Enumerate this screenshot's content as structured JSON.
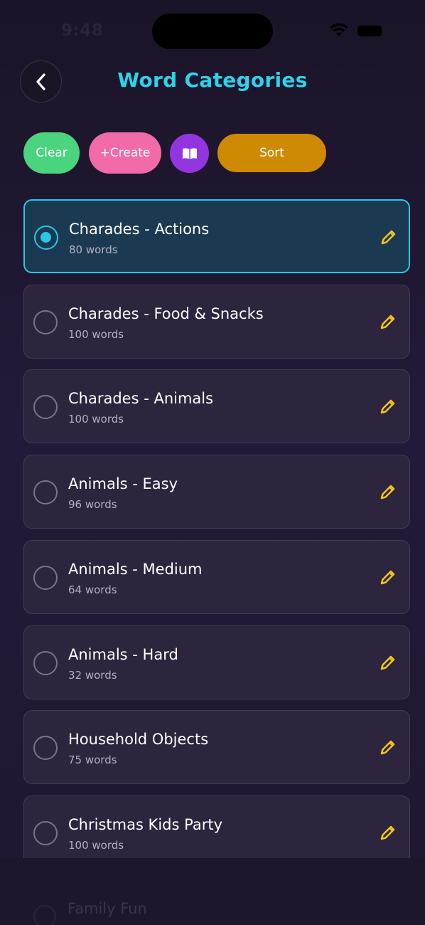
{
  "status_bar": {
    "time": "9:48"
  },
  "header": {
    "title": "Word Categories"
  },
  "toolbar": {
    "clear_label": "Clear",
    "create_label": "+Create",
    "sort_label": "Sort"
  },
  "colors": {
    "title": "#2ed3ea",
    "clear": "#4ad47e",
    "create": "#f26aa8",
    "book": "#9235e0",
    "sort": "#cf8a04",
    "selected_border": "#2bc6e6",
    "edit_icon": "#f3c418"
  },
  "categories": [
    {
      "name": "Charades - Actions",
      "count": "80 words",
      "selected": true
    },
    {
      "name": "Charades - Food & Snacks",
      "count": "100 words",
      "selected": false
    },
    {
      "name": "Charades - Animals",
      "count": "100 words",
      "selected": false
    },
    {
      "name": "Animals - Easy",
      "count": "96 words",
      "selected": false
    },
    {
      "name": "Animals - Medium",
      "count": "64 words",
      "selected": false
    },
    {
      "name": "Animals - Hard",
      "count": "32 words",
      "selected": false
    },
    {
      "name": "Household Objects",
      "count": "75 words",
      "selected": false
    },
    {
      "name": "Christmas Kids Party",
      "count": "100 words",
      "selected": false
    }
  ],
  "partially_hidden_item": "Family Fun"
}
